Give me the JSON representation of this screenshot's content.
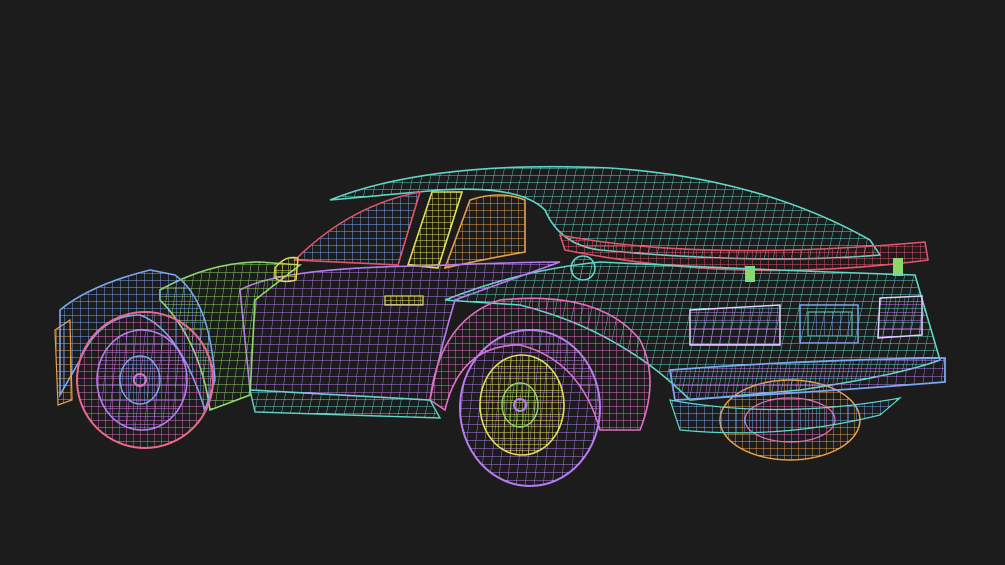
{
  "scene": {
    "background": "#1c1c1c",
    "subject": "car-wireframe",
    "palette": {
      "cyan": "#5fd6c6",
      "blue": "#7aa6f0",
      "purple": "#b77df0",
      "magenta": "#e06fc0",
      "pink": "#e86a8c",
      "green": "#8fd66a",
      "yellow": "#e2df5a",
      "orange": "#e8a04a",
      "red": "#e0556a"
    }
  }
}
